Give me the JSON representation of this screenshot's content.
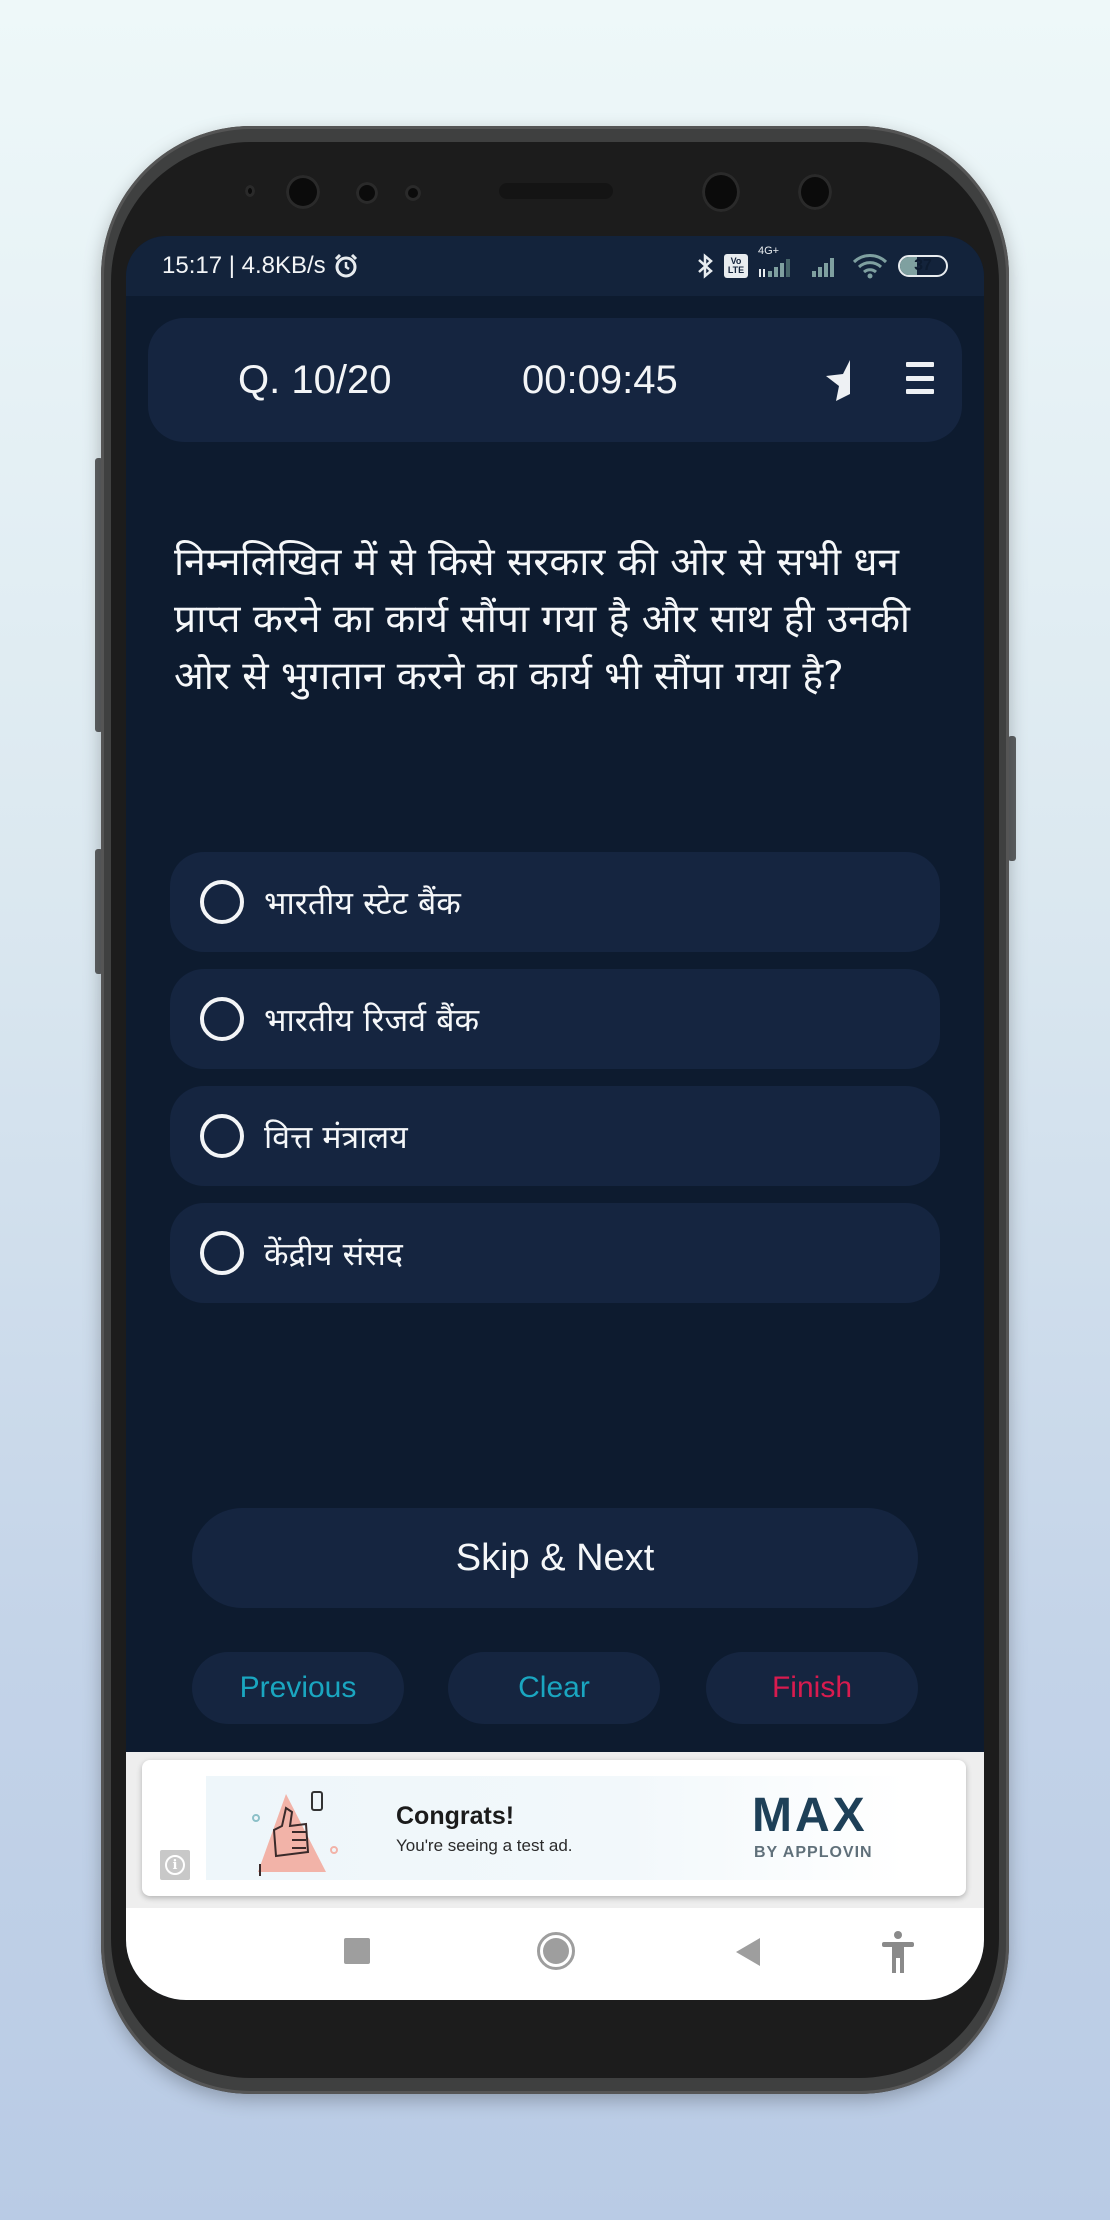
{
  "status_bar": {
    "time_speed": "15:17 | 4.8KB/s",
    "network_type": "4G+",
    "volte_label_top": "Vo",
    "volte_label_bottom": "LTE",
    "battery_level": "37",
    "battery_percent": 37
  },
  "header": {
    "question_counter": "Q. 10/20",
    "timer": "00:09:45"
  },
  "question": {
    "text": "निम्नलिखित में से किसे सरकार की ओर से सभी धन प्राप्त करने का कार्य सौंपा गया है और साथ ही उनकी ओर से भुगतान करने का कार्य भी सौंपा गया है?"
  },
  "options": [
    {
      "label": "भारतीय स्टेट बैंक",
      "selected": false
    },
    {
      "label": "भारतीय रिजर्व बैंक",
      "selected": false
    },
    {
      "label": "वित्त मंत्रालय",
      "selected": false
    },
    {
      "label": "केंद्रीय संसद",
      "selected": false
    }
  ],
  "actions": {
    "skip_next": "Skip & Next",
    "previous": "Previous",
    "clear": "Clear",
    "finish": "Finish"
  },
  "colors": {
    "background": "#0d1b2f",
    "card": "#152540",
    "accent_teal": "#1aa6c0",
    "accent_red": "#d81b4f"
  },
  "ad": {
    "title": "Congrats!",
    "subtitle": "You're seeing a test ad.",
    "brand": "MAX",
    "brand_sub": "BY APPLOVIN",
    "info_glyph": "i"
  }
}
